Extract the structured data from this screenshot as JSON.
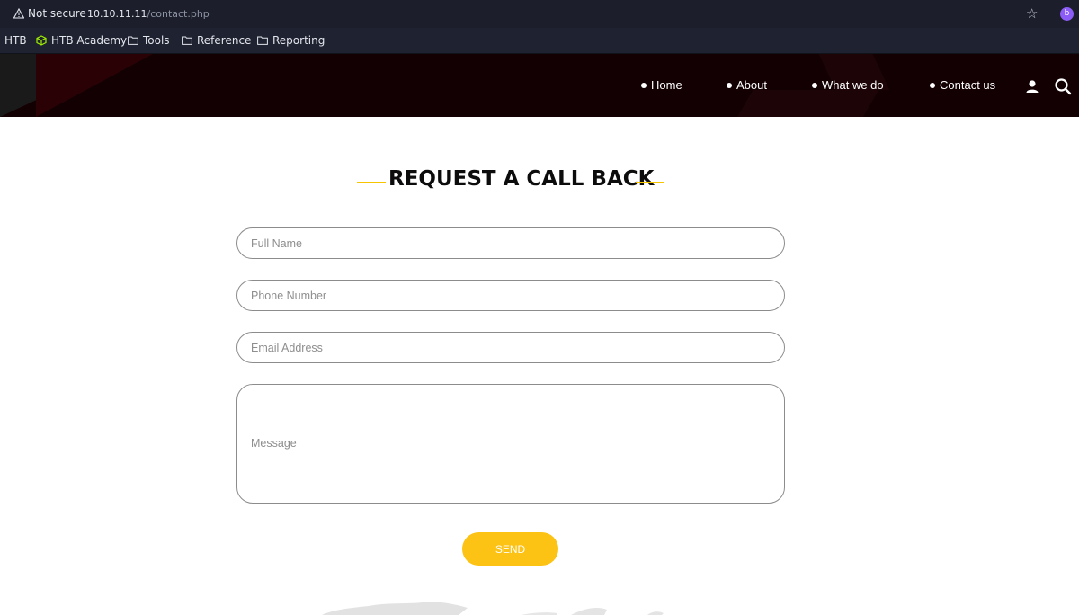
{
  "browser": {
    "security_label": "Not secure",
    "url_host": "10.10.11.11",
    "url_path": "/contact.php",
    "profile_initial": "b"
  },
  "bookmarks": [
    {
      "label": "HTB",
      "icon": "none"
    },
    {
      "label": "HTB Academy",
      "icon": "htb-cube-icon"
    },
    {
      "label": "Tools",
      "icon": "folder-icon"
    },
    {
      "label": "Reference",
      "icon": "folder-icon"
    },
    {
      "label": "Reporting",
      "icon": "folder-icon"
    }
  ],
  "nav": {
    "items": [
      "Home",
      "About",
      "What we do",
      "Contact us"
    ],
    "icons": [
      "user-icon",
      "search-icon"
    ]
  },
  "form": {
    "title": "REQUEST A CALL BACK",
    "full_name_placeholder": "Full Name",
    "phone_placeholder": "Phone Number",
    "email_placeholder": "Email Address",
    "message_placeholder": "Message",
    "send_label": "SEND"
  },
  "colors": {
    "accent": "#fcc214",
    "header_bg": "#120003",
    "browser_bg": "#1c1f2b"
  }
}
